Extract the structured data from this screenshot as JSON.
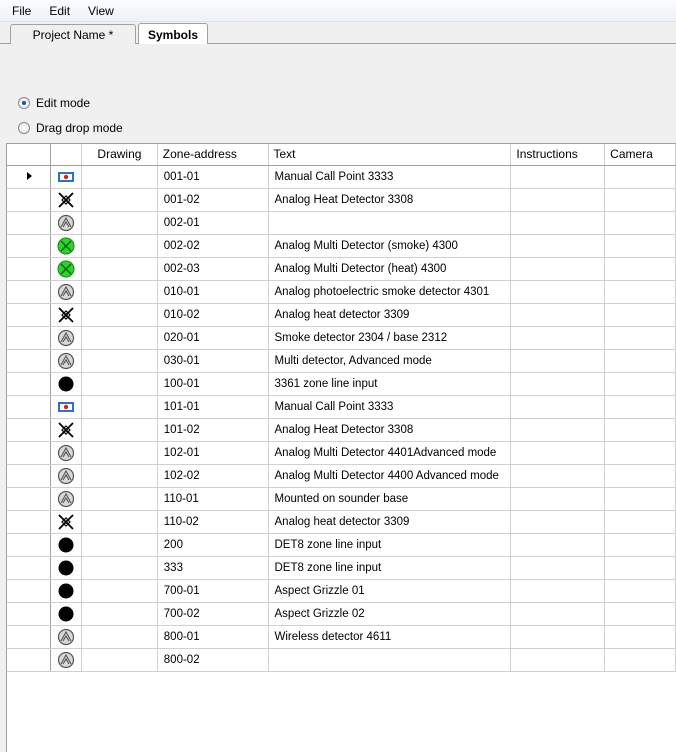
{
  "menu": {
    "items": [
      "File",
      "Edit",
      "View"
    ]
  },
  "tabs": {
    "project": "Project Name *",
    "symbols": "Symbols"
  },
  "options": {
    "edit_mode": "Edit mode",
    "drag_drop_mode": "Drag drop mode",
    "selected": "edit_mode"
  },
  "table": {
    "columns": [
      "",
      "Drawing",
      "Zone-address",
      "Text",
      "Instructions",
      "Camera"
    ],
    "rows": [
      {
        "icon": "manual-call-point-icon",
        "zone": "001-01",
        "text": "Manual Call Point 3333",
        "selected": true
      },
      {
        "icon": "heat-detector-icon",
        "zone": "001-02",
        "text": "Analog Heat Detector 3308"
      },
      {
        "icon": "smoke-detector-icon",
        "zone": "002-01",
        "text": ""
      },
      {
        "icon": "multi-detector-green-icon",
        "zone": "002-02",
        "text": "Analog Multi Detector (smoke) 4300"
      },
      {
        "icon": "multi-detector-green-icon",
        "zone": "002-03",
        "text": "Analog Multi Detector (heat) 4300"
      },
      {
        "icon": "smoke-detector-icon",
        "zone": "010-01",
        "text": "Analog photoelectric smoke detector 4301"
      },
      {
        "icon": "heat-detector-icon",
        "zone": "010-02",
        "text": "Analog heat detector 3309"
      },
      {
        "icon": "smoke-detector-icon",
        "zone": "020-01",
        "text": "Smoke detector 2304 / base 2312"
      },
      {
        "icon": "smoke-detector-icon",
        "zone": "030-01",
        "text": "Multi detector, Advanced mode"
      },
      {
        "icon": "zone-line-input-icon",
        "zone": "100-01",
        "text": "3361 zone line input"
      },
      {
        "icon": "manual-call-point-icon",
        "zone": "101-01",
        "text": "Manual Call Point 3333"
      },
      {
        "icon": "heat-detector-icon",
        "zone": "101-02",
        "text": "Analog Heat Detector 3308"
      },
      {
        "icon": "smoke-detector-icon",
        "zone": "102-01",
        "text": "Analog Multi Detector 4401Advanced mode"
      },
      {
        "icon": "smoke-detector-icon",
        "zone": "102-02",
        "text": "Analog Multi Detector 4400 Advanced mode"
      },
      {
        "icon": "smoke-detector-icon",
        "zone": "110-01",
        "text": "Mounted on sounder base"
      },
      {
        "icon": "heat-detector-icon",
        "zone": "110-02",
        "text": "Analog heat detector 3309"
      },
      {
        "icon": "zone-line-input-icon",
        "zone": "200",
        "text": "DET8 zone line input"
      },
      {
        "icon": "zone-line-input-icon",
        "zone": "333",
        "text": "DET8 zone line input"
      },
      {
        "icon": "zone-line-input-icon",
        "zone": "700-01",
        "text": "Aspect Grizzle 01"
      },
      {
        "icon": "zone-line-input-icon",
        "zone": "700-02",
        "text": "Aspect Grizzle 02"
      },
      {
        "icon": "smoke-detector-icon",
        "zone": "800-01",
        "text": "Wireless detector 4611"
      },
      {
        "icon": "smoke-detector-icon",
        "zone": "800-02",
        "text": ""
      }
    ]
  }
}
